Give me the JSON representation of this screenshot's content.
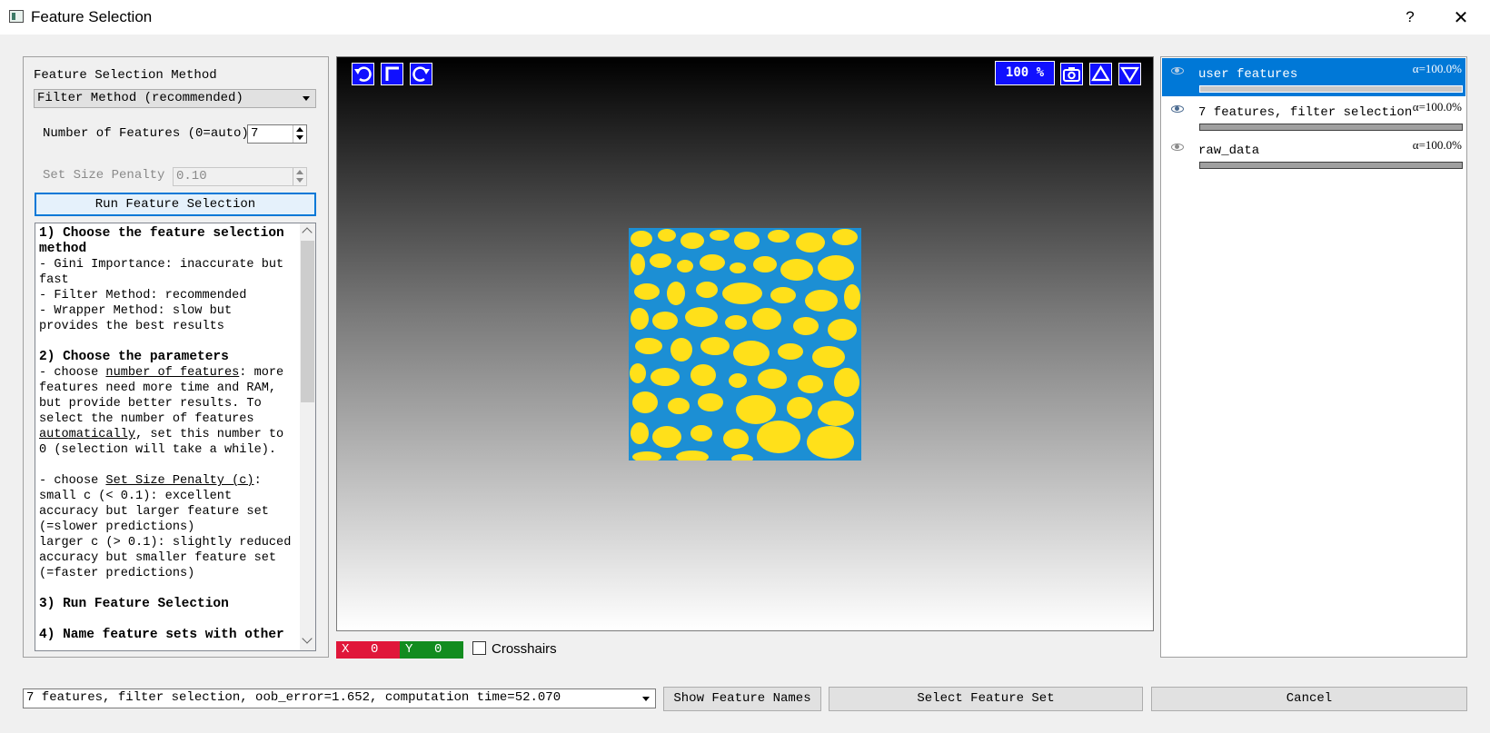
{
  "window": {
    "title": "Feature Selection",
    "help": "?",
    "close": "✕"
  },
  "left_panel": {
    "method_label": "Feature Selection Method",
    "method_value": "Filter Method (recommended)",
    "num_features_label": "Number of Features (0=auto)",
    "num_features_value": "7",
    "penalty_label": "Set Size Penalty",
    "penalty_value": "0.10",
    "run_button": "Run Feature Selection",
    "help": {
      "h1": "1) Choose the feature selection method",
      "p1": "- Gini Importance: inaccurate but fast\n- Filter Method: recommended\n- Wrapper Method: slow but provides the best results\n",
      "h2": "2) Choose the parameters",
      "p2a": "- choose ",
      "p2b": "number of features",
      "p2c": ": more features need more time and RAM, but provide better results. To select the number of features ",
      "p2d": "automatically",
      "p2e": ", set this number to 0 (selection will take a while).\n\n- choose ",
      "p2f": "Set Size Penalty (c)",
      "p2g": ":\nsmall c (< 0.1): excellent accuracy but larger feature set (=slower predictions)\nlarger c (> 0.1): slightly reduced accuracy but smaller feature set (=faster predictions)\n",
      "h3": "3) Run Feature Selection",
      "h4": "4) Name feature sets with other"
    }
  },
  "viewer": {
    "zoom": "100 %",
    "icons": [
      "undo-icon",
      "crop-icon",
      "redo-icon",
      "camera-icon",
      "triangle-up-icon",
      "triangle-down-icon"
    ],
    "colors": {
      "foreground": "#ffe01a",
      "background": "#1c8fd4",
      "button": "#1010ff"
    }
  },
  "coords": {
    "x_label": "X",
    "x_value": "0",
    "y_label": "Y",
    "y_value": "0"
  },
  "crosshairs_label": "Crosshairs",
  "layers": [
    {
      "name": "user features",
      "alpha": "α=100.0%",
      "selected": true
    },
    {
      "name": "7 features, filter selection",
      "alpha": "α=100.0%",
      "selected": false
    },
    {
      "name": "raw_data",
      "alpha": "α=100.0%",
      "selected": false
    }
  ],
  "bottom": {
    "feature_set_value": "7 features, filter selection, oob_error=1.652, computation time=52.070",
    "show_names_button": "Show Feature Names",
    "select_set_button": "Select Feature Set",
    "cancel_button": "Cancel"
  }
}
